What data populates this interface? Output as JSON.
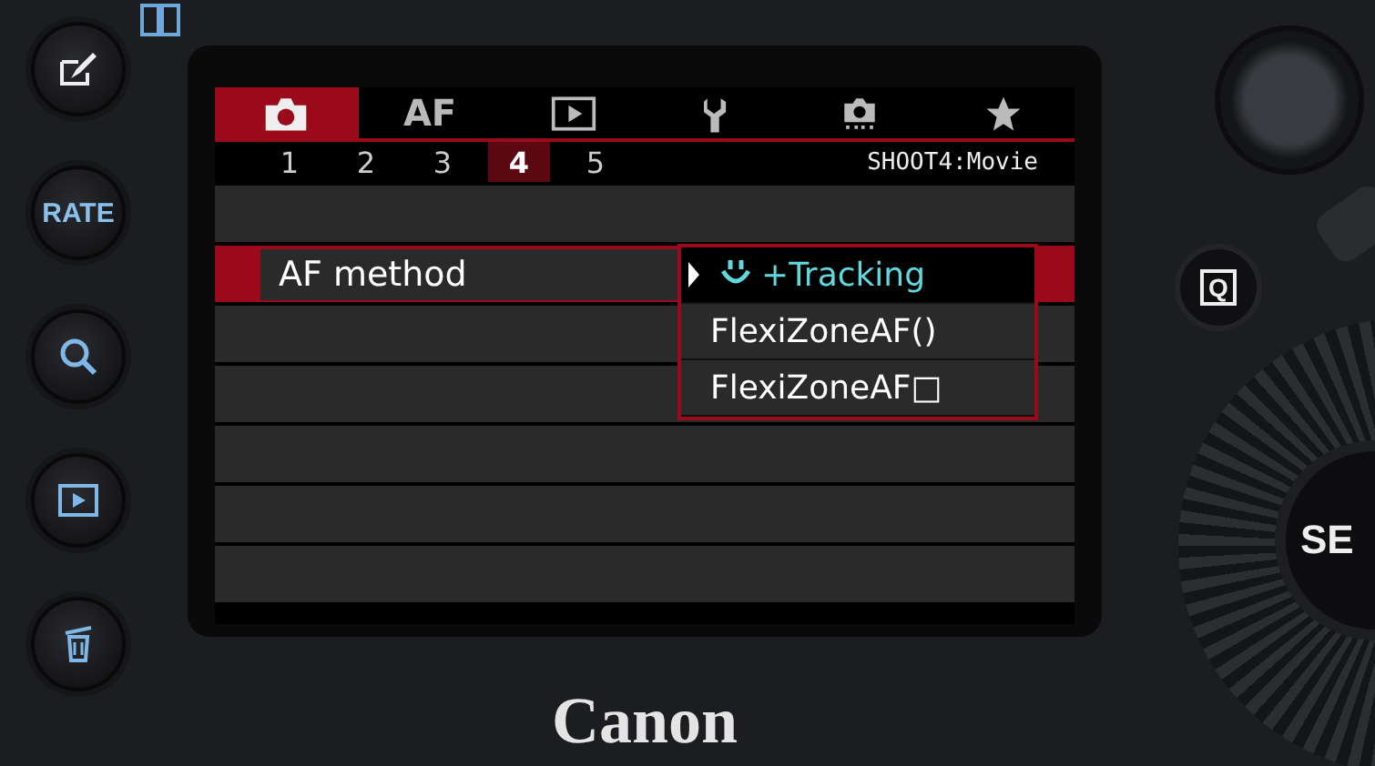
{
  "camera": {
    "left_buttons": [
      {
        "kind": "edit"
      },
      {
        "kind": "text",
        "label": "RATE"
      },
      {
        "kind": "magnify"
      },
      {
        "kind": "playback"
      },
      {
        "kind": "trash"
      }
    ],
    "q_button": {
      "label": "Q"
    },
    "set_button": {
      "label": "SE"
    },
    "brand": "Canon"
  },
  "menu": {
    "tabs": [
      {
        "kind": "camera",
        "selected": true
      },
      {
        "kind": "text",
        "label": "AF",
        "selected": false
      },
      {
        "kind": "playback",
        "selected": false
      },
      {
        "kind": "wrench",
        "selected": false
      },
      {
        "kind": "camera_dots",
        "selected": false
      },
      {
        "kind": "star",
        "selected": false
      }
    ],
    "pages": [
      {
        "label": "1",
        "selected": false
      },
      {
        "label": "2",
        "selected": false
      },
      {
        "label": "3",
        "selected": false
      },
      {
        "label": "4",
        "selected": true
      },
      {
        "label": "5",
        "selected": false
      }
    ],
    "page_title": "SHOOT4:Movie",
    "rows": [
      {
        "kind": "blank"
      },
      {
        "kind": "item",
        "label": "AF method",
        "selected": true
      },
      {
        "kind": "blank"
      },
      {
        "kind": "blank"
      },
      {
        "kind": "blank"
      },
      {
        "kind": "blank"
      },
      {
        "kind": "blank"
      }
    ],
    "dropdown": [
      {
        "label": "+Tracking",
        "kind": "face",
        "selected": true
      },
      {
        "label": "FlexiZoneAF()",
        "selected": false
      },
      {
        "label": "FlexiZoneAF□",
        "selected": false
      }
    ]
  }
}
